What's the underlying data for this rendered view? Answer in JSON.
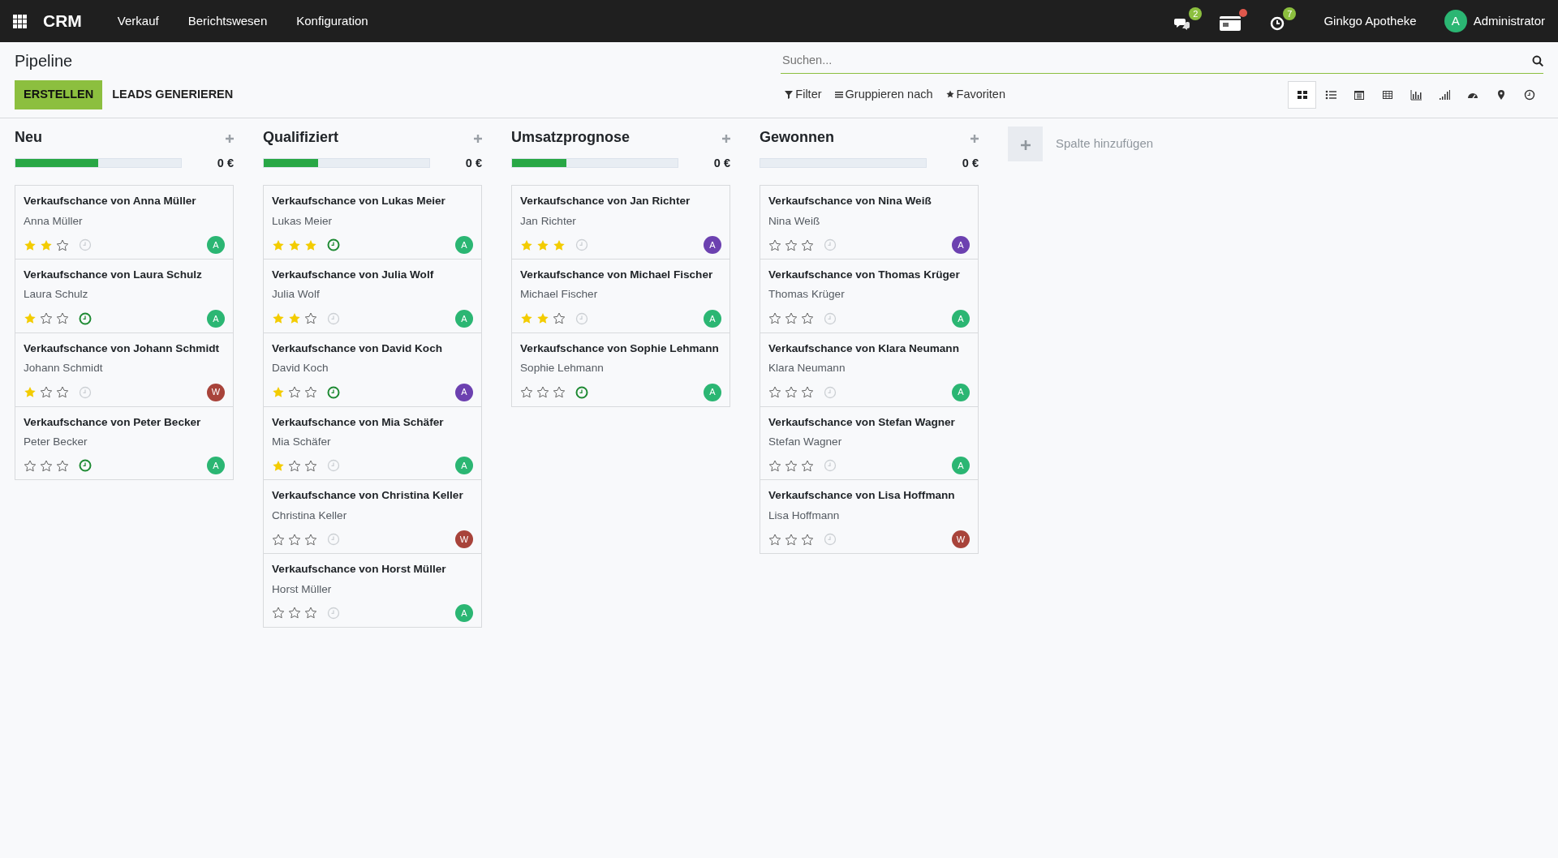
{
  "navbar": {
    "app": "CRM",
    "menu": [
      "Verkauf",
      "Berichtswesen",
      "Konfiguration"
    ],
    "systray": [
      {
        "kind": "chat",
        "badge": "2"
      },
      {
        "kind": "card",
        "dot": true
      },
      {
        "kind": "clock",
        "badge": "7"
      }
    ],
    "company": "Ginkgo Apotheke",
    "user": {
      "initial": "A",
      "name": "Administrator"
    }
  },
  "control_panel": {
    "title": "Pipeline",
    "buttons": [
      {
        "label": "ERSTELLEN",
        "kind": "primary"
      },
      {
        "label": "LEADS GENERIEREN",
        "kind": "plain"
      }
    ],
    "search": {
      "placeholder": "Suchen..."
    },
    "filters": [
      {
        "kind": "filter",
        "label": "Filter"
      },
      {
        "kind": "group",
        "label": "Gruppieren nach"
      },
      {
        "kind": "star",
        "label": "Favoriten"
      }
    ],
    "views": [
      {
        "kind": "kanban",
        "selected": true
      },
      {
        "kind": "list",
        "selected": false
      },
      {
        "kind": "calendar",
        "selected": false
      },
      {
        "kind": "pivot",
        "selected": false
      },
      {
        "kind": "graph",
        "selected": false
      },
      {
        "kind": "cohort",
        "selected": false
      },
      {
        "kind": "dashboard",
        "selected": false
      },
      {
        "kind": "map",
        "selected": false
      },
      {
        "kind": "activity",
        "selected": false
      }
    ]
  },
  "columns": [
    {
      "title": "Neu",
      "level": 0.5,
      "total": "0 €",
      "cards": [
        {
          "title": "Verkaufschance von Anna Müller",
          "name": "Anna Müller",
          "stars": 2,
          "activity_planned": false,
          "avatar": "A",
          "color": "#2bb673"
        },
        {
          "title": "Verkaufschance von Laura Schulz",
          "name": "Laura Schulz",
          "stars": 1,
          "activity_planned": true,
          "avatar": "A",
          "color": "#2bb673"
        },
        {
          "title": "Verkaufschance von Johann Schmidt",
          "name": "Johann Schmidt",
          "stars": 1,
          "activity_planned": false,
          "avatar": "W",
          "color": "#a8433a"
        },
        {
          "title": "Verkaufschance von Peter Becker",
          "name": "Peter Becker",
          "stars": 0,
          "activity_planned": true,
          "avatar": "A",
          "color": "#2bb673"
        }
      ]
    },
    {
      "title": "Qualifiziert",
      "level": 0.33,
      "total": "0 €",
      "cards": [
        {
          "title": "Verkaufschance von Lukas Meier",
          "name": "Lukas Meier",
          "stars": 3,
          "activity_planned": true,
          "avatar": "A",
          "color": "#2bb673"
        },
        {
          "title": "Verkaufschance von Julia Wolf",
          "name": "Julia Wolf",
          "stars": 2,
          "activity_planned": false,
          "avatar": "A",
          "color": "#2bb673"
        },
        {
          "title": "Verkaufschance von David Koch",
          "name": "David Koch",
          "stars": 1,
          "activity_planned": true,
          "avatar": "A",
          "color": "#6c41b0"
        },
        {
          "title": "Verkaufschance von Mia Schäfer",
          "name": "Mia Schäfer",
          "stars": 1,
          "activity_planned": false,
          "avatar": "A",
          "color": "#2bb673"
        },
        {
          "title": "Verkaufschance von Christina Keller",
          "name": "Christina Keller",
          "stars": 0,
          "activity_planned": false,
          "avatar": "W",
          "color": "#a8433a"
        },
        {
          "title": "Verkaufschance von Horst Müller",
          "name": "Horst Müller",
          "stars": 0,
          "activity_planned": false,
          "avatar": "A",
          "color": "#2bb673"
        }
      ]
    },
    {
      "title": "Umsatzprognose",
      "level": 0.33,
      "total": "0 €",
      "cards": [
        {
          "title": "Verkaufschance von Jan Richter",
          "name": "Jan Richter",
          "stars": 3,
          "activity_planned": false,
          "avatar": "A",
          "color": "#6c41b0"
        },
        {
          "title": "Verkaufschance von Michael Fischer",
          "name": "Michael Fischer",
          "stars": 2,
          "activity_planned": false,
          "avatar": "A",
          "color": "#2bb673"
        },
        {
          "title": "Verkaufschance von Sophie Lehmann",
          "name": "Sophie Lehmann",
          "stars": 0,
          "activity_planned": true,
          "avatar": "A",
          "color": "#2bb673"
        }
      ]
    },
    {
      "title": "Gewonnen",
      "level": 0,
      "total": "0 €",
      "cards": [
        {
          "title": "Verkaufschance von Nina Weiß",
          "name": "Nina Weiß",
          "stars": 0,
          "activity_planned": false,
          "avatar": "A",
          "color": "#6c41b0"
        },
        {
          "title": "Verkaufschance von Thomas Krüger",
          "name": "Thomas Krüger",
          "stars": 0,
          "activity_planned": false,
          "avatar": "A",
          "color": "#2bb673"
        },
        {
          "title": "Verkaufschance von Klara Neumann",
          "name": "Klara Neumann",
          "stars": 0,
          "activity_planned": false,
          "avatar": "A",
          "color": "#2bb673"
        },
        {
          "title": "Verkaufschance von Stefan Wagner",
          "name": "Stefan Wagner",
          "stars": 0,
          "activity_planned": false,
          "avatar": "A",
          "color": "#2bb673"
        },
        {
          "title": "Verkaufschance von Lisa Hoffmann",
          "name": "Lisa Hoffmann",
          "stars": 0,
          "activity_planned": false,
          "avatar": "W",
          "color": "#a8433a"
        }
      ]
    }
  ],
  "add_column": {
    "label": "Spalte hinzufügen"
  }
}
